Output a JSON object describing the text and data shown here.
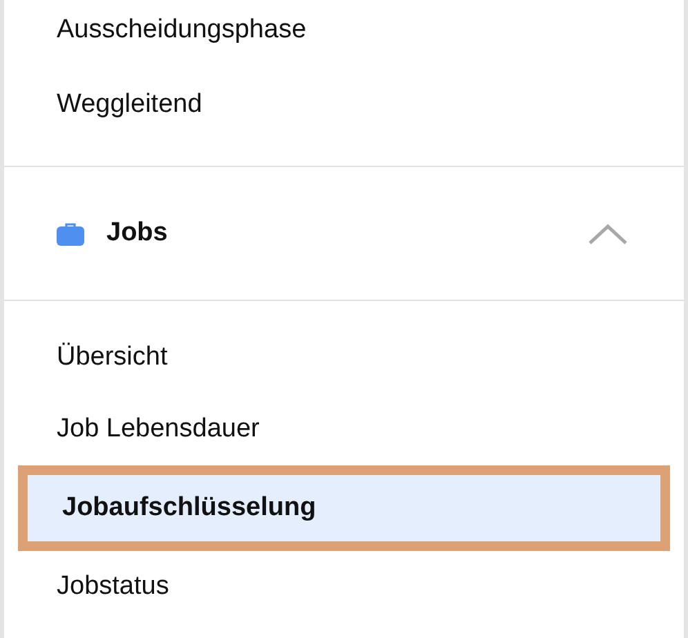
{
  "menu_items": [
    {
      "label": "Ausscheidungsphase",
      "selected": false
    },
    {
      "label": "Weggleitend",
      "selected": false
    }
  ],
  "section": {
    "title": "Jobs",
    "expanded": true,
    "items": [
      {
        "label": "Übersicht",
        "selected": false
      },
      {
        "label": "Job Lebensdauer",
        "selected": false
      },
      {
        "label": "Jobaufschlüsselung",
        "selected": true
      },
      {
        "label": "Jobstatus",
        "selected": false
      }
    ]
  }
}
